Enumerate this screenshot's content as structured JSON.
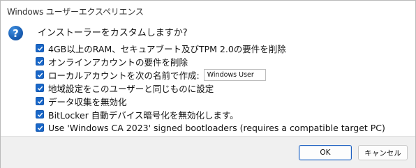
{
  "window": {
    "title": "Windows ユーザーエクスペリエンス"
  },
  "dialog": {
    "icon": "question-icon",
    "question": "インストーラーをカスタムしますか?",
    "options": [
      {
        "label": "4GB以上のRAM、セキュアブート及びTPM 2.0の要件を削除",
        "checked": true
      },
      {
        "label": "オンラインアカウントの要件を削除",
        "checked": true
      },
      {
        "label": "ローカルアカウントを次の名前で作成:",
        "checked": true,
        "input_value": "Windows User"
      },
      {
        "label": "地域設定をこのユーザーと同じものに設定",
        "checked": true
      },
      {
        "label": "データ収集を無効化",
        "checked": true
      },
      {
        "label": "BitLocker 自動デバイス暗号化を無効化します。",
        "checked": true
      },
      {
        "label": "Use 'Windows CA 2023' signed bootloaders (requires a compatible target PC)",
        "checked": true
      }
    ]
  },
  "buttons": {
    "ok": "OK",
    "cancel": "キャンセル"
  },
  "colors": {
    "checkbox": "#1967c8",
    "icon_blue": "#1a5fb4",
    "footer_bg": "#f0f0f0"
  }
}
